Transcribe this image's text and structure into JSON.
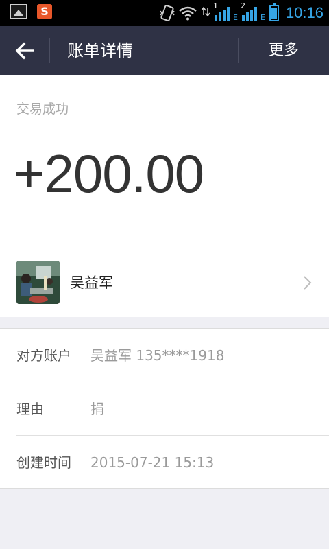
{
  "status_bar": {
    "time": "10:16",
    "sim1_label": "1",
    "sim2_label": "2",
    "network_type": "E",
    "icons": [
      "gallery-icon",
      "sogou-icon",
      "vibrate-icon",
      "wifi-icon",
      "data-arrows-icon",
      "signal-icon",
      "battery-charging-icon"
    ]
  },
  "header": {
    "back_icon": "arrow-left-icon",
    "title": "账单详情",
    "more_label": "更多"
  },
  "transaction": {
    "status": "交易成功",
    "amount": "+200.00"
  },
  "contact": {
    "name": "吴益军",
    "chevron_icon": "chevron-right-icon"
  },
  "details": [
    {
      "label": "对方账户",
      "value": "吴益军 135****1918"
    },
    {
      "label": "理由",
      "value": "捐"
    },
    {
      "label": "创建时间",
      "value": "2015-07-21 15:13"
    }
  ],
  "colors": {
    "header_bg": "#2f3245",
    "page_bg": "#efeff4",
    "status_accent": "#36a5e6"
  }
}
